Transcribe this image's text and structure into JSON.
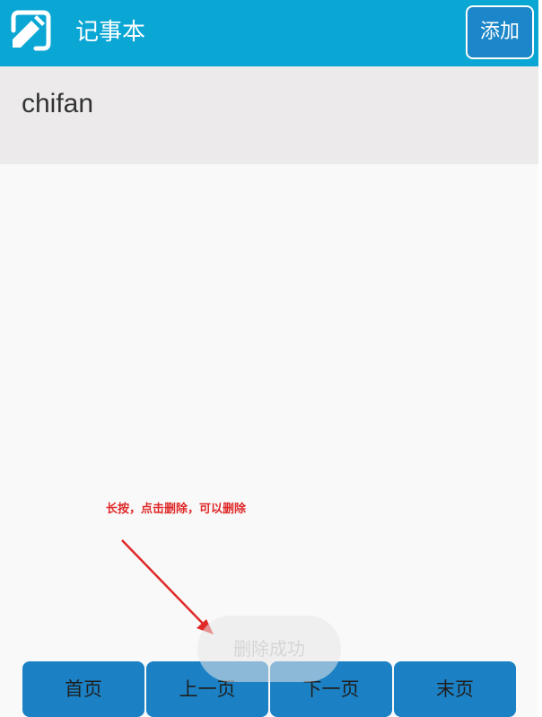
{
  "appbar": {
    "icon": "notepad-pen-icon",
    "title": "记事本",
    "add_label": "添加"
  },
  "notes": [
    {
      "title": "chifan"
    }
  ],
  "annotation": {
    "text": "长按，点击删除，可以删除",
    "color": "#e02828"
  },
  "toast": {
    "text": "删除成功"
  },
  "pager": {
    "first": "首页",
    "prev": "上一页",
    "next": "下一页",
    "last": "末页"
  },
  "colors": {
    "appbar": "#0aa6d4",
    "button": "#1b81c4",
    "note_bg": "#eceaea",
    "page_bg": "#f9f9f9"
  }
}
